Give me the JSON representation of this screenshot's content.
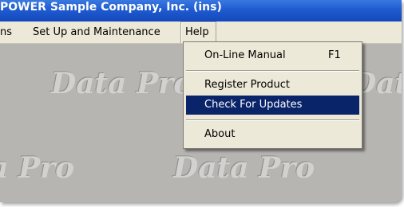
{
  "window": {
    "title": "POWER Sample Company, Inc. (ins)"
  },
  "menubar": {
    "items": [
      {
        "label": "ns"
      },
      {
        "label": "Set Up and Maintenance"
      },
      {
        "label": "Help"
      }
    ]
  },
  "help_menu": {
    "items": [
      {
        "label": "On-Line Manual",
        "shortcut": "F1"
      },
      {
        "label": "Register Product",
        "shortcut": ""
      },
      {
        "label": "Check For Updates",
        "shortcut": ""
      },
      {
        "label": "About",
        "shortcut": ""
      }
    ],
    "highlighted": "Check For Updates"
  },
  "background": {
    "watermark_text": "Data Pro"
  },
  "colors": {
    "titlebar": "#1f5bd0",
    "menubar": "#ece9d8",
    "desktop": "#b7b5b1",
    "highlight": "#0a246a"
  }
}
